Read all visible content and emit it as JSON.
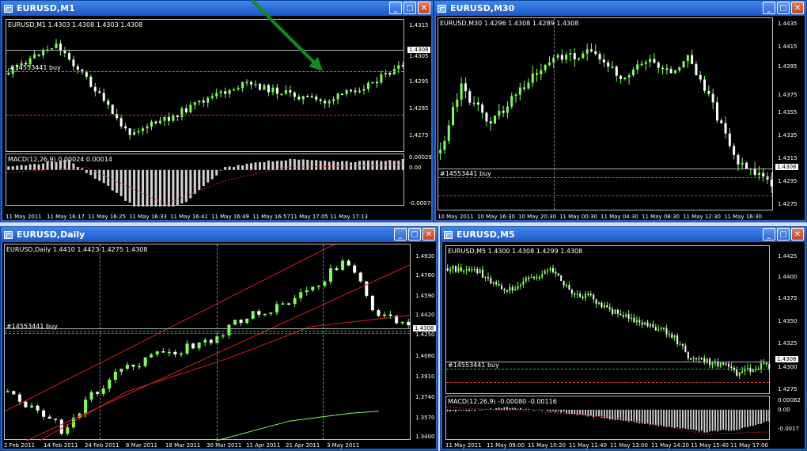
{
  "windows": {
    "m1": {
      "title": "EURUSD,M1",
      "info": "EURUSD,M1  1.4303 1.4308 1.4303 1.4308",
      "order": "#14553441 buy",
      "price_tag": "1.4308",
      "y_ticks": [
        "1.4315",
        "1.4305",
        "1.4295",
        "1.4285",
        "1.4275"
      ],
      "macd_label": "MACD(12,26,9) 0.00024 0.00014",
      "macd_ticks": [
        "0.00029",
        "0.00",
        "-0.00074"
      ],
      "x_ticks": [
        "11 May 2011",
        "11 May 16:17",
        "11 May 16:25",
        "11 May 16:33",
        "11 May 16:41",
        "11 May 16:49",
        "11 May 16:57",
        "11 May 17:05",
        "11 May 17:13"
      ]
    },
    "m30": {
      "title": "EURUSD,M30",
      "info": "EURUSD,M30  1.4296 1.4308 1.4289 1.4308",
      "order": "#14553441 buy",
      "price_tag": "1.4308",
      "y_ticks": [
        "1.4435",
        "1.4415",
        "1.4395",
        "1.4375",
        "1.4355",
        "1.4335",
        "1.4315",
        "1.4295",
        "1.4275"
      ],
      "x_ticks": [
        "10 May 2011",
        "10 May 16:30",
        "10 May 20:30",
        "11 May 00:30",
        "11 May 04:30",
        "11 May 08:30",
        "11 May 12:30",
        "11 May 16:30"
      ]
    },
    "daily": {
      "title": "EURUSD,Daily",
      "info": "EURUSD,Daily  1.4410 1.4423 1.4275 1.4308",
      "order": "#14553441 buy",
      "price_tag": "1.4308",
      "y_ticks": [
        "1.4930",
        "1.4760",
        "1.4590",
        "1.4420",
        "1.4250",
        "1.4080",
        "1.3910",
        "1.3740",
        "1.3570",
        "1.3400"
      ],
      "x_ticks": [
        "2 Feb 2011",
        "14 Feb 2011",
        "24 Feb 2011",
        "8 Mar 2011",
        "18 Mar 2011",
        "30 Mar 2011",
        "11 Apr 2011",
        "21 Apr 2011",
        "3 May 2011"
      ]
    },
    "m5": {
      "title": "EURUSD,M5",
      "info": "EURUSD,M5  1.4300 1.4308 1.4299 1.4308",
      "order": "#14553441 buy",
      "price_tag": "1.4308",
      "y_ticks": [
        "1.4425",
        "1.4400",
        "1.4375",
        "1.4350",
        "1.4325",
        "1.4300",
        "1.4275"
      ],
      "macd_label": "MACD(12,26,9) -0.00080 -0.00116",
      "macd_ticks": [
        "0.00082",
        "0.00",
        "-0.0017"
      ],
      "x_ticks": [
        "11 May 2011",
        "11 May 09:00",
        "11 May 10:20",
        "11 May 11:40",
        "11 May 13:00",
        "11 May 14:20",
        "11 May 15:40",
        "11 May 17:00"
      ]
    }
  },
  "buttons": {
    "min": "_",
    "max": "□",
    "close": "✕"
  },
  "colors": {
    "bull": "#7dff5a",
    "bear": "#ffffff",
    "wick": "#7dff5a",
    "ma": "#d42020",
    "signal": "#d42020",
    "grid": "#888888"
  }
}
